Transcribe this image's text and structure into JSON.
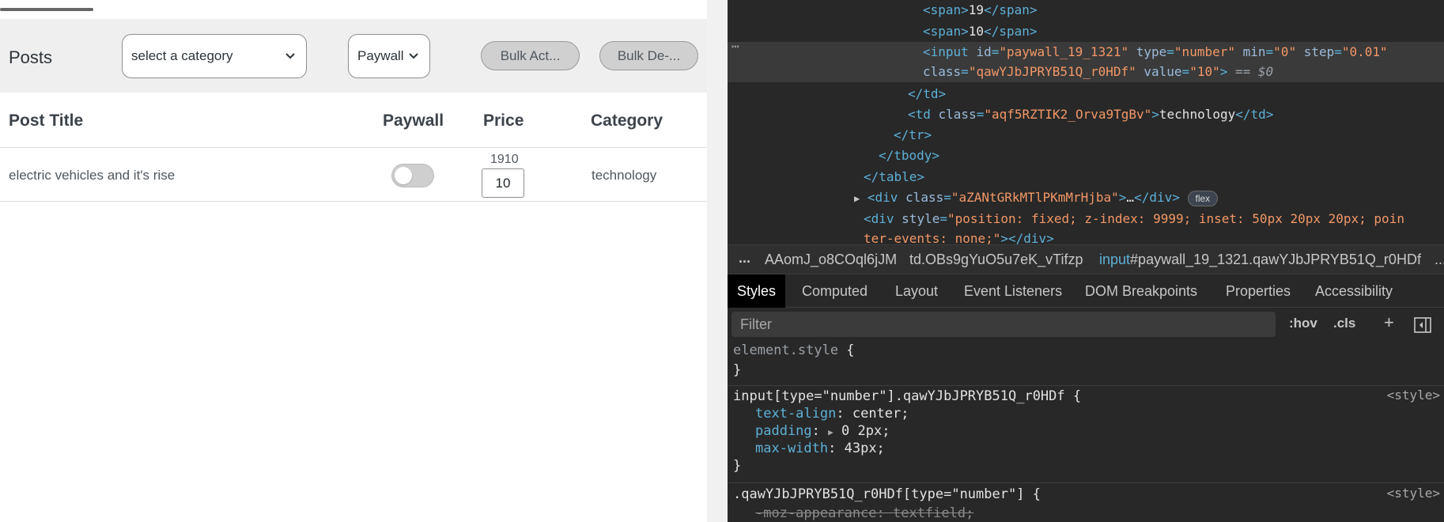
{
  "page": {
    "posts_title": "Posts",
    "category_select": "select a category",
    "paywall_select": "Paywall",
    "bulk_action_btn": "Bulk Act...",
    "bulk_delete_btn": "Bulk De-...",
    "table": {
      "headers": [
        "Post Title",
        "Paywall",
        "Price",
        "Category"
      ],
      "row": {
        "title": "electric vehicles and it's rise",
        "paywall_on": false,
        "price_label": "1910",
        "price_value": "10",
        "category": "technology"
      }
    }
  },
  "devtools": {
    "dom": {
      "span1_text": "19",
      "span2_text": "10",
      "input_id": "\"paywall_19_1321\"",
      "input_type": "\"number\"",
      "input_min": "\"0\"",
      "input_step": "\"0.01\"",
      "input_class": "\"qawYJbJPRYB51Q_r0HDf\"",
      "input_value": "\"10\"",
      "eq_marker": " == $0",
      "td_class": "\"aqf5RZTIK2_Orva9TgBv\"",
      "td_text": "technology",
      "div_class": "\"aZANtGRkMTlPKmMrHjba\"",
      "flex_badge": "flex",
      "div_style": "\"position: fixed; z-index: 9999; inset: 50px 20px 20px; poin",
      "div_style_cont": "ter-events: none;\""
    },
    "breadcrumbs": [
      "...",
      "AAomJ_o8COql6jJM",
      "td.OBs9gYuO5u7eK_vTifzp",
      "input#paywall_19_1321.qawYJbJPRYB51Q_r0HDf",
      "..."
    ],
    "tabs": [
      "Styles",
      "Computed",
      "Layout",
      "Event Listeners",
      "DOM Breakpoints",
      "Properties",
      "Accessibility"
    ],
    "filter_placeholder": "Filter",
    "filter_tools": [
      ":hov",
      ".cls",
      "+"
    ],
    "styles": {
      "element_style": "element.style {",
      "rule1_selector": "input[type=\"number\"].qawYJbJPRYB51Q_r0HDf {",
      "rule1_src": "<style>",
      "rule1_props": [
        {
          "name": "text-align",
          "value": "center;"
        },
        {
          "name": "padding",
          "value": "0 2px;"
        },
        {
          "name": "max-width",
          "value": "43px;"
        }
      ],
      "rule2_selector": ".qawYJbJPRYB51Q_r0HDf[type=\"number\"] {",
      "rule2_src": "<style>",
      "rule2_prop": "-moz-appearance: textfield;"
    }
  }
}
